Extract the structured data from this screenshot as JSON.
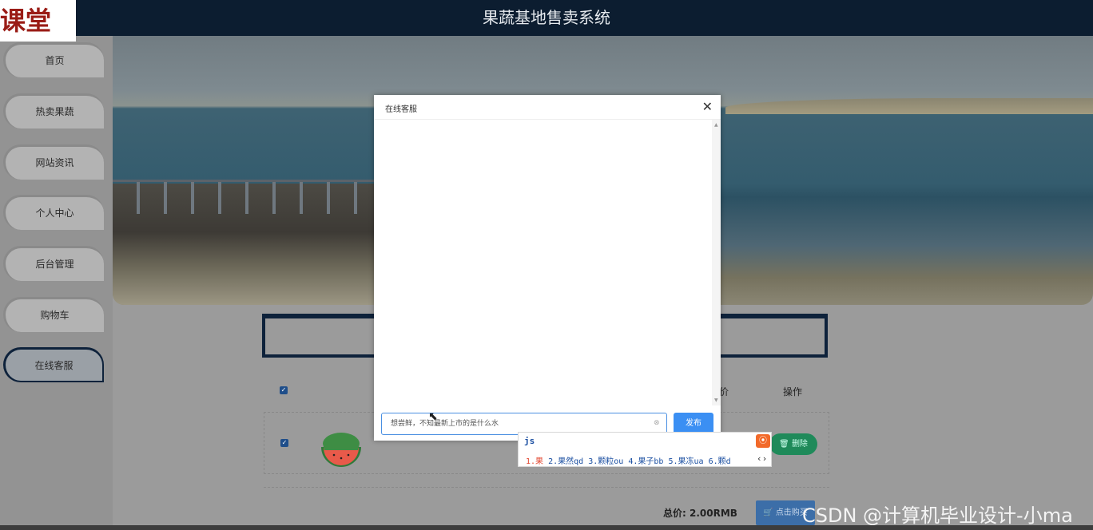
{
  "app": {
    "title": "果蔬基地售卖系统",
    "logo_text": "课堂"
  },
  "sidebar": {
    "items": [
      {
        "label": "首页"
      },
      {
        "label": "热卖果蔬"
      },
      {
        "label": "网站资讯"
      },
      {
        "label": "个人中心"
      },
      {
        "label": "后台管理"
      },
      {
        "label": "购物车"
      },
      {
        "label": "在线客服",
        "active": true
      }
    ]
  },
  "cart": {
    "columns": {
      "price": "价",
      "operation": "操作"
    },
    "row": {
      "checked": true,
      "delete_label": "删除",
      "product_image": "watermelon-slice"
    },
    "total_label": "总价: 2.00RMB",
    "buy_label": "点击购买"
  },
  "modal": {
    "title": "在线客服",
    "close_icon": "close-icon",
    "input_value": "想尝鲜，不知最新上市的是什么水",
    "send_label": "发布"
  },
  "ime": {
    "composition": "js",
    "candidates": [
      "1.果",
      "2.果然qd",
      "3.颗粒ou",
      "4.果子bb",
      "5.果冻ua",
      "6.颗d"
    ]
  },
  "watermark": "CSDN @计算机毕业设计-小ma",
  "colors": {
    "header_bg": "#0c1d30",
    "accent_blue": "#3b8ff3",
    "delete_green": "#1f8a5a"
  }
}
